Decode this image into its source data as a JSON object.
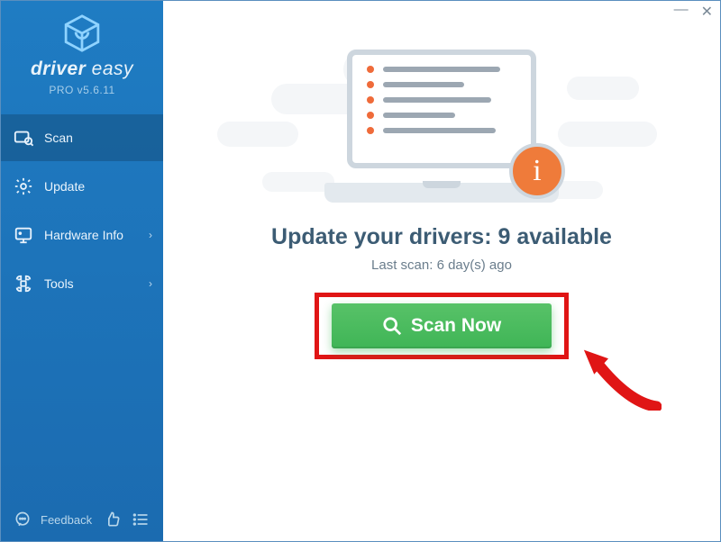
{
  "brand": {
    "name_a": "driver",
    "name_b": "easy",
    "version": "PRO v5.6.11"
  },
  "titlebar": {
    "min": "—",
    "close": "✕"
  },
  "sidebar": {
    "items": [
      {
        "label": "Scan",
        "icon": "scan",
        "chevron": false,
        "selected": true
      },
      {
        "label": "Update",
        "icon": "update",
        "chevron": false,
        "selected": false
      },
      {
        "label": "Hardware Info",
        "icon": "hardware",
        "chevron": true,
        "selected": false
      },
      {
        "label": "Tools",
        "icon": "tools",
        "chevron": true,
        "selected": false
      }
    ],
    "feedback_label": "Feedback"
  },
  "main": {
    "headline_prefix": "Update your drivers: ",
    "available_count": 9,
    "headline_suffix": " available",
    "last_scan_prefix": "Last scan: ",
    "last_scan_value": "6 day(s) ago",
    "scan_button_label": "Scan Now",
    "info_badge_glyph": "i"
  },
  "colors": {
    "sidebar": "#1f7cc3",
    "accent_orange": "#ef7b3a",
    "scan_green": "#3fb556",
    "highlight_red": "#e01515",
    "headline": "#3c5c74"
  }
}
